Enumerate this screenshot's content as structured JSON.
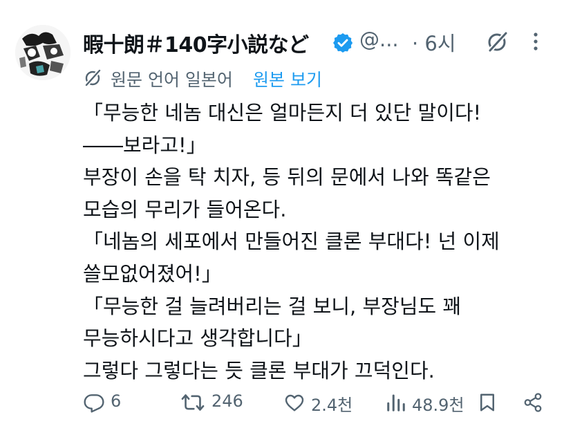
{
  "post": {
    "author_name": "暇十朗＃140字小説など",
    "handle": "@...",
    "time": "· 6시"
  },
  "translation": {
    "label": "원문 언어 일본어",
    "link": "원본 보기"
  },
  "body_lines": [
    "「무능한 네놈 대신은 얼마든지 더 있단 말이다!",
    "――보라고!」",
    "부장이 손을 탁 치자, 등 뒤의 문에서 나와 똑같은",
    "모습의 무리가 들어온다.",
    "「네놈의 세포에서 만들어진 클론 부대다! 넌 이제",
    "쓸모없어졌어!」",
    "「무능한 걸 늘려버리는 걸 보니, 부장님도 꽤",
    "무능하시다고 생각합니다」",
    "그렇다 그렇다는 듯 클론 부대가 끄덕인다."
  ],
  "actions": {
    "replies": "6",
    "reposts": "246",
    "likes": "2.4천",
    "views": "48.9천"
  },
  "colors": {
    "text": "#0f1419",
    "muted": "#536471",
    "link": "#1d9bf0",
    "verified": "#1d9bf0"
  },
  "icons": [
    "avatar",
    "verified-badge-icon",
    "grok-icon",
    "more-icon",
    "translate-icon",
    "reply-icon",
    "repost-icon",
    "like-icon",
    "views-icon",
    "bookmark-icon",
    "share-icon"
  ]
}
